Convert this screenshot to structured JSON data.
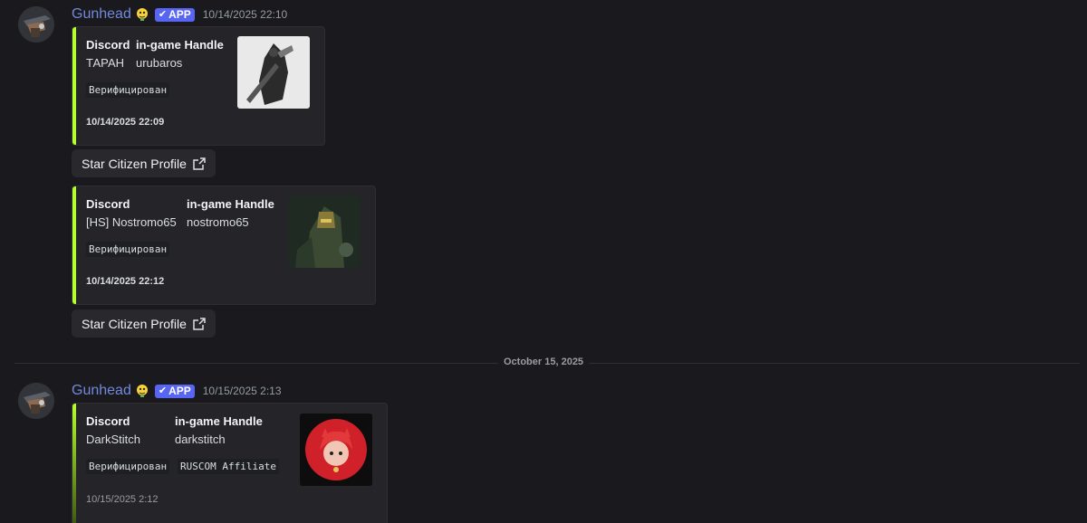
{
  "messages": [
    {
      "author": "Gunhead",
      "app_tag": "APP",
      "timestamp": "10/14/2025 22:10",
      "embeds": [
        {
          "field1_name": "Discord",
          "field1_value": "ТАРАН",
          "field2_name": "in-game Handle",
          "field2_value": "urubaros",
          "tags": [
            "Верифицирован"
          ],
          "footer": "10/14/2025 22:09",
          "button": "Star Citizen Profile"
        },
        {
          "field1_name": "Discord",
          "field1_value": "[HS] Nostromo65",
          "field2_name": "in-game Handle",
          "field2_value": "nostromo65",
          "tags": [
            "Верифицирован"
          ],
          "footer": "10/14/2025 22:12",
          "button": "Star Citizen Profile"
        }
      ]
    },
    {
      "author": "Gunhead",
      "app_tag": "APP",
      "timestamp": "10/15/2025 2:13",
      "embeds": [
        {
          "field1_name": "Discord",
          "field1_value": "DarkStitch",
          "field2_name": "in-game Handle",
          "field2_value": "darkstitch",
          "tags": [
            "Верифицирован",
            "RUSCOM Affiliate"
          ],
          "footer": "10/15/2025 2:12"
        }
      ]
    }
  ],
  "date_divider": "October 15, 2025",
  "colors": {
    "background": "#1a1a1e",
    "embed_bar": "#b5ff2f",
    "app_tag": "#5865f2",
    "username": "#7289da"
  },
  "icons": {
    "external_link": "external-link-icon",
    "check": "check-icon",
    "bot_badge": "bot-badge-emoji"
  }
}
